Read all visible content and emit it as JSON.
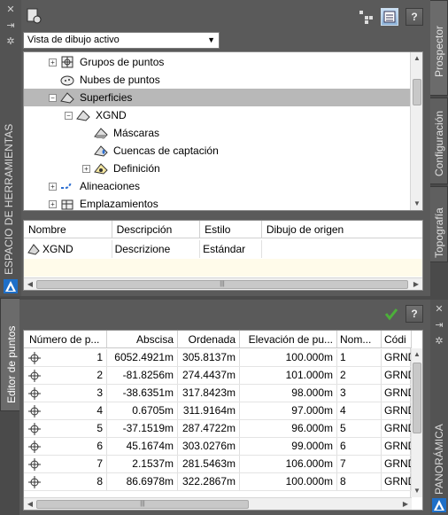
{
  "toolspace": {
    "title": "ESPACIO DE HERRAMIENTAS",
    "view_selector": {
      "value": "Vista de dibujo activo",
      "options": [
        "Vista de dibujo activo"
      ]
    },
    "tabs": [
      {
        "label": "Prospector",
        "active": true
      },
      {
        "label": "Configuración",
        "active": false
      },
      {
        "label": "Topografía",
        "active": false
      }
    ],
    "tree": [
      {
        "label": "Grupos de puntos",
        "icon": "point-groups-icon",
        "level": 1,
        "expander": "+"
      },
      {
        "label": "Nubes de puntos",
        "icon": "point-clouds-icon",
        "level": 1,
        "expander": ""
      },
      {
        "label": "Superficies",
        "icon": "surfaces-icon",
        "level": 1,
        "expander": "-",
        "selected": true
      },
      {
        "label": "XGND",
        "icon": "surface-icon",
        "level": 2,
        "expander": "-"
      },
      {
        "label": "Máscaras",
        "icon": "masks-icon",
        "level": 3,
        "expander": ""
      },
      {
        "label": "Cuencas de captación",
        "icon": "watersheds-icon",
        "level": 3,
        "expander": ""
      },
      {
        "label": "Definición",
        "icon": "definition-icon",
        "level": 3,
        "expander": "+"
      },
      {
        "label": "Alineaciones",
        "icon": "alignments-icon",
        "level": 1,
        "expander": "+"
      },
      {
        "label": "Emplazamientos",
        "icon": "sites-icon",
        "level": 1,
        "expander": "+"
      }
    ],
    "list": {
      "columns": [
        "Nombre",
        "Descripción",
        "Estilo",
        "Dibujo de origen"
      ],
      "rows": [
        {
          "name": "XGND",
          "description": "Descrizione",
          "style": "Estándar",
          "source": ""
        }
      ]
    }
  },
  "point_editor": {
    "title": "Editor de puntos",
    "side_label": "PANORÁMICA",
    "columns": [
      "Número de p...",
      "Abscisa",
      "Ordenada",
      "Elevación de pu...",
      "Nom...",
      "Códi"
    ],
    "rows": [
      {
        "num": "1",
        "x": "6052.4921m",
        "y": "305.8137m",
        "z": "100.000m",
        "name": "1",
        "code": "GRND"
      },
      {
        "num": "2",
        "x": "-81.8256m",
        "y": "274.4437m",
        "z": "101.000m",
        "name": "2",
        "code": "GRND"
      },
      {
        "num": "3",
        "x": "-38.6351m",
        "y": "317.8423m",
        "z": "98.000m",
        "name": "3",
        "code": "GRND"
      },
      {
        "num": "4",
        "x": "0.6705m",
        "y": "311.9164m",
        "z": "97.000m",
        "name": "4",
        "code": "GRND"
      },
      {
        "num": "5",
        "x": "-37.1519m",
        "y": "287.4722m",
        "z": "96.000m",
        "name": "5",
        "code": "GRND"
      },
      {
        "num": "6",
        "x": "45.1674m",
        "y": "303.0276m",
        "z": "99.000m",
        "name": "6",
        "code": "GRND"
      },
      {
        "num": "7",
        "x": "2.1537m",
        "y": "281.5463m",
        "z": "106.000m",
        "name": "7",
        "code": "GRND"
      },
      {
        "num": "8",
        "x": "86.6978m",
        "y": "322.2867m",
        "z": "100.000m",
        "name": "8",
        "code": "GRND"
      }
    ]
  },
  "colors": {
    "palette_bg": "#5a5a5a",
    "selection": "#b8b8b8",
    "accent_blue": "#1e6fc8",
    "check_green": "#4caf3a"
  },
  "help_label": "?"
}
